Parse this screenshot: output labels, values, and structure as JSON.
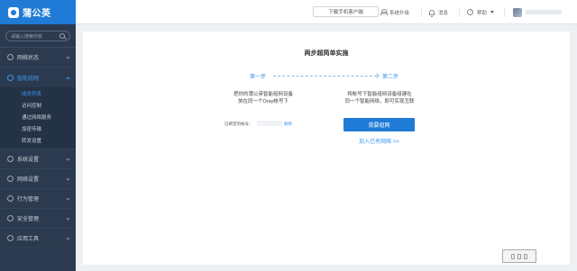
{
  "app": {
    "name": "蒲公英"
  },
  "sidebar": {
    "search_placeholder": "请输入搜索内容",
    "items": [
      {
        "label": "网络状态"
      },
      {
        "label": "智能组网",
        "sub": [
          "成员列表",
          "访问控制",
          "通过网络服务",
          "加密传输",
          "转发设置"
        ]
      },
      {
        "label": "系统设置"
      },
      {
        "label": "网络设置"
      },
      {
        "label": "行为管理"
      },
      {
        "label": "安全管理"
      },
      {
        "label": "应用工具"
      }
    ]
  },
  "topbar": {
    "download_label": "下载手机客户端",
    "upgrade_label": "系统升级",
    "messages_label": "消息",
    "help_label": "帮助"
  },
  "card": {
    "title": "两步超简单实施",
    "step1": "第一步",
    "step2": "第二步",
    "step1_desc_line1": "把你的蒲公英智能组网设备",
    "step1_desc_line2": "放在同一个Oray帐号下",
    "step2_desc_line1": "将帐号下智能组网设备组建在",
    "step2_desc_line2": "同一个智能网络，即可实现互联",
    "sn_label": "已绑定的帐号：",
    "unbind_label": "解绑",
    "primary_button": "我要组网",
    "join_link": "加入已有网络 >>"
  }
}
